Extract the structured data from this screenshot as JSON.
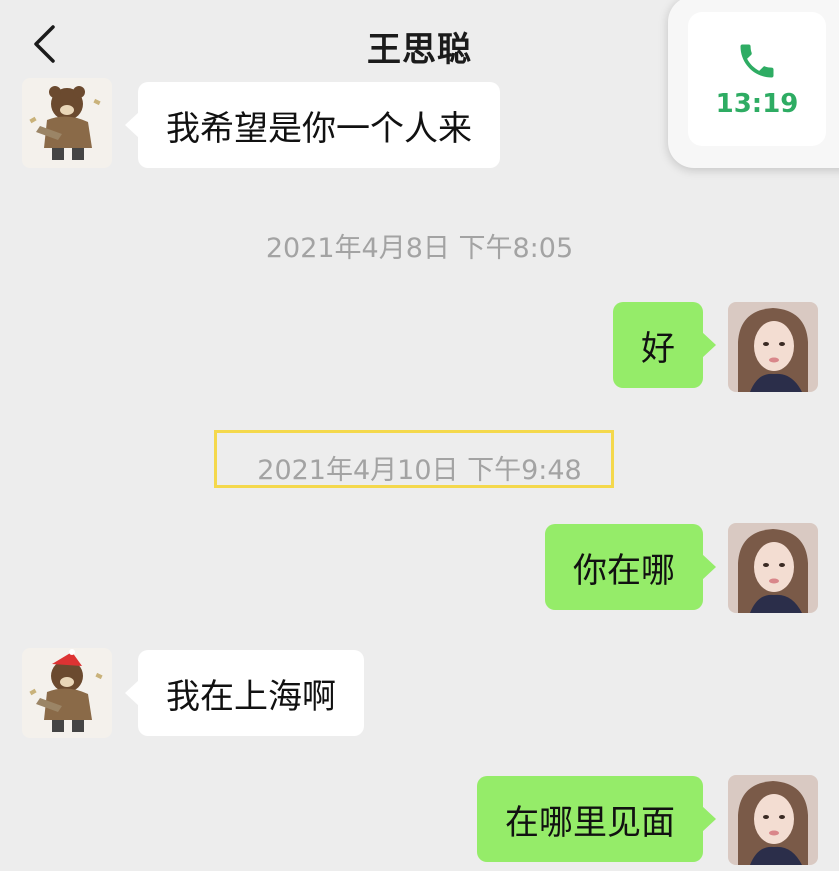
{
  "header": {
    "title": "王思聪",
    "back_icon": "chevron-left-icon"
  },
  "call": {
    "time": "13:19",
    "icon": "phone-icon",
    "color": "#2eac63"
  },
  "messages": {
    "m1": "我希望是你一个人来",
    "t1": "2021年4月8日 下午8:05",
    "m2": "好",
    "t2": "2021年4月10日 下午9:48",
    "m3": "你在哪",
    "m4": "我在上海啊",
    "m5": "在哪里见面"
  },
  "colors": {
    "outgoing_bubble": "#95ec69",
    "incoming_bubble": "#ffffff",
    "background": "#ededed",
    "highlight_box": "#f4d84c"
  }
}
